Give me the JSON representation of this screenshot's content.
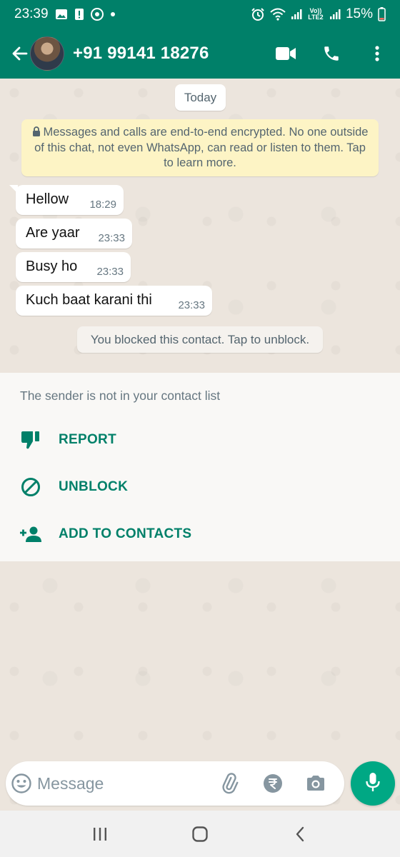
{
  "status_bar": {
    "time": "23:39",
    "battery": "15%",
    "network_label": "Vo)) LTE2",
    "icons": [
      "gallery-icon",
      "alert-icon",
      "chrome-icon",
      "dot-icon",
      "alarm-icon",
      "wifi-icon",
      "signal-icon",
      "signal-icon",
      "battery-icon"
    ]
  },
  "header": {
    "contact_name": "+91 99141 18276",
    "icons": [
      "back-arrow-icon",
      "video-call-icon",
      "phone-icon",
      "more-icon"
    ]
  },
  "chat": {
    "date_chip": "Today",
    "encryption_notice": "Messages and calls are end-to-end encrypted. No one outside of this chat, not even WhatsApp, can read or listen to them. Tap to learn more.",
    "messages": [
      {
        "text": "Hellow",
        "time": "18:29"
      },
      {
        "text": "Are yaar",
        "time": "23:33"
      },
      {
        "text": "Busy ho",
        "time": "23:33"
      },
      {
        "text": "Kuch baat karani thi",
        "time": "23:33"
      }
    ],
    "blocked_notice": "You blocked this contact. Tap to unblock."
  },
  "sender_panel": {
    "note": "The sender is not in your contact list",
    "actions": [
      {
        "label": "REPORT",
        "icon": "thumbs-down-icon"
      },
      {
        "label": "UNBLOCK",
        "icon": "block-icon"
      },
      {
        "label": "ADD TO CONTACTS",
        "icon": "add-person-icon"
      }
    ]
  },
  "composer": {
    "placeholder": "Message",
    "icons": [
      "emoji-icon",
      "attach-icon",
      "rupee-icon",
      "camera-icon",
      "mic-icon"
    ]
  },
  "nav": {
    "icons": [
      "recents-icon",
      "home-icon",
      "back-icon"
    ]
  },
  "colors": {
    "brand": "#008069",
    "accent": "#00a884",
    "chat_bg": "#ece5dd",
    "notice_bg": "#fdf4c5"
  }
}
